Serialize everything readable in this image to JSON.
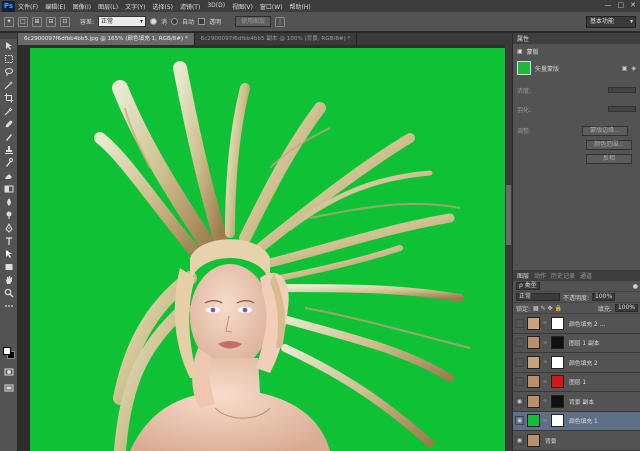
{
  "app": {
    "logo": "Ps"
  },
  "menu": [
    "文件(F)",
    "编辑(E)",
    "图像(I)",
    "图层(L)",
    "文字(Y)",
    "选择(S)",
    "滤镜(T)",
    "3D(D)",
    "视图(V)",
    "窗口(W)",
    "帮助(H)"
  ],
  "window_controls": [
    "—",
    "□",
    "✕"
  ],
  "options": {
    "feather_label": "容差:",
    "mode_label": "模式:",
    "mode_value": "正常",
    "option_1": "消",
    "option_2": "自动",
    "option_3": "透明",
    "checkbox_label": "连",
    "preview_button": "使用图层",
    "workspace": "基本功能"
  },
  "tabs": [
    {
      "label": "6c2900097f6dfbb4bb5.jpg @ 165% (颜色填充 1, RGB/8#) *",
      "active": true
    },
    {
      "label": "6c2900097f6dfbb4bb5 副本 @ 100% (背景, RGB/8#) *",
      "active": false
    }
  ],
  "properties": {
    "tab_label": "属性",
    "panel_label": "蒙版",
    "mask_label": "矢量蒙版",
    "density_label": "浓度:",
    "feather_label": "羽化:",
    "adjust_label": "调整:",
    "btn_edge": "蒙版边缘...",
    "btn_color": "颜色范围...",
    "btn_invert": "反相"
  },
  "layers_panel": {
    "tabs": [
      "图层",
      "动作",
      "历史记录",
      "通道"
    ],
    "filter": "ρ 类型",
    "blend_mode": "正常",
    "opacity_label": "不透明度:",
    "opacity_value": "100%",
    "lock_label": "锁定:",
    "fill_label": "填充:",
    "fill_value": "100%",
    "layers": [
      {
        "name": "颜色填充 2 ...",
        "visible": false,
        "selected": false,
        "thumb": "#c8a47c",
        "mask": "#ffffff"
      },
      {
        "name": "图层 1 副本",
        "visible": false,
        "selected": false,
        "thumb": "#b98f6e",
        "mask": "#111111"
      },
      {
        "name": "颜色填充 2",
        "visible": false,
        "selected": false,
        "thumb": "#c8a47c",
        "mask": "#ffffff"
      },
      {
        "name": "图层 1",
        "visible": false,
        "selected": false,
        "thumb": "#b98f6e",
        "mask": "#d01a1a"
      },
      {
        "name": "背景 副本",
        "visible": true,
        "selected": false,
        "thumb": "#b98f6e",
        "mask": "#111111"
      },
      {
        "name": "颜色填充 1",
        "visible": true,
        "selected": true,
        "thumb": "#0fc235",
        "mask": "#ffffff"
      },
      {
        "name": "背景",
        "visible": true,
        "selected": false,
        "thumb": "#b98f6e",
        "mask": ""
      }
    ]
  }
}
